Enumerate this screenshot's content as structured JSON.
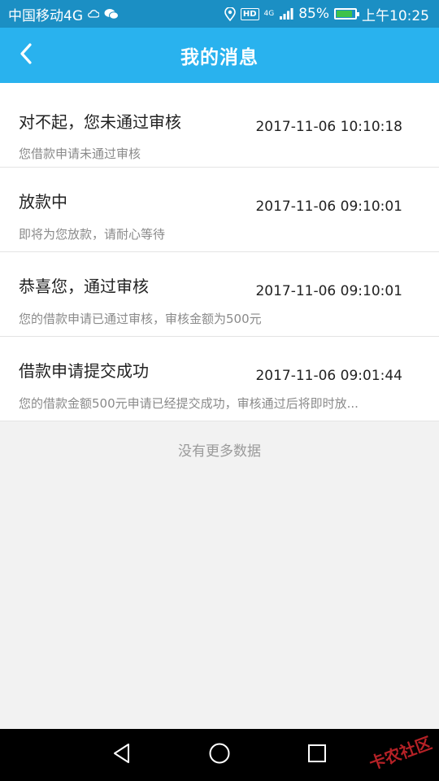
{
  "statusbar": {
    "carrier": "中国移动4G",
    "network_tag_top": "4G",
    "battery": "85%",
    "battery_level": 0.85,
    "time": "上午10:25",
    "hd": "HD"
  },
  "header": {
    "title": "我的消息"
  },
  "messages": [
    {
      "title": "对不起，您未通过审核",
      "time": "2017-11-06 10:10:18",
      "desc": "您借款申请未通过审核"
    },
    {
      "title": "放款中",
      "time": "2017-11-06 09:10:01",
      "desc": "即将为您放款，请耐心等待"
    },
    {
      "title": "恭喜您，通过审核",
      "time": "2017-11-06 09:10:01",
      "desc": "您的借款申请已通过审核，审核金额为500元"
    },
    {
      "title": "借款申请提交成功",
      "time": "2017-11-06 09:01:44",
      "desc": "您的借款金额500元申请已经提交成功，审核通过后将即时放..."
    }
  ],
  "footer": {
    "no_more": "没有更多数据"
  },
  "watermark": "卡农社区",
  "colors": {
    "header": "#29b2ee",
    "statusbar": "#1b8fc4"
  }
}
